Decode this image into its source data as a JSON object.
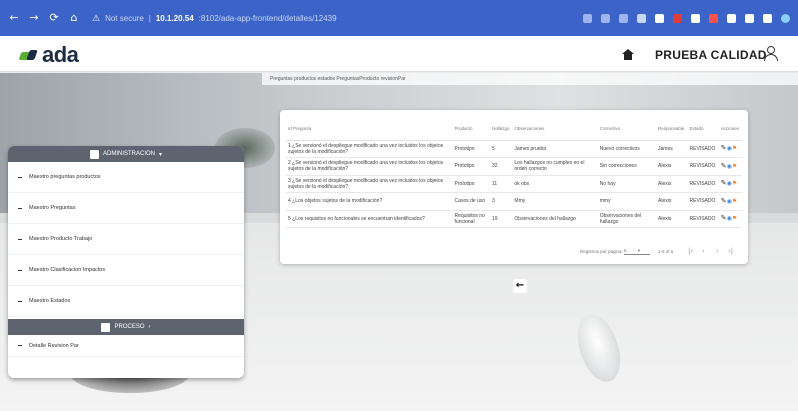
{
  "browser": {
    "security": "Not secure",
    "host": "10.1.20.54",
    "path": ":8102/ada-app-frontend/detalles/12439"
  },
  "header": {
    "logo_text": "ada",
    "user_name": "PRUEBA CALIDAD"
  },
  "breadcrumb": "Preguntas   productos   estados   PreguntasProducto   revisionPar",
  "table": {
    "columns": [
      "Id Pregunta",
      "Producto",
      "Hallazgo",
      "Observaciones",
      "Correctivo",
      "Responsable",
      "Estado",
      "Acciones"
    ],
    "rows": [
      {
        "id": "1",
        "pregunta": "¿Se versionó el despliegue modificado una vez incluidos los objetos sujetos de la modificación?",
        "producto": "Prototipo",
        "hallazgo": "5",
        "observaciones": "James prueba",
        "correctivo": "Nuevo correctivos",
        "responsable": "James",
        "estado": "REVISADO"
      },
      {
        "id": "2",
        "pregunta": "¿Se versionó el despliegue modificado una vez incluidos los objetos sujetos de la modificación?",
        "producto": "Prototipo",
        "hallazgo": "32",
        "observaciones": "Los hallazgos no cumplen en el orden correcto",
        "correctivo": "Sin correcciones",
        "responsable": "Alexis",
        "estado": "REVISADO"
      },
      {
        "id": "3",
        "pregunta": "¿Se versionó el despliegue modificado una vez incluidos los objetos sujetos de la modificación?",
        "producto": "Prototipo",
        "hallazgo": "11",
        "observaciones": "ok obs",
        "correctivo": "No hay",
        "responsable": "Alexis",
        "estado": "REVISADO"
      },
      {
        "id": "4",
        "pregunta": "¿Los objetos sujetos de la modificación?",
        "producto": "Casos de uso",
        "hallazgo": "3",
        "observaciones": "Mmy",
        "correctivo": "mmy",
        "responsable": "Alexis",
        "estado": "REVISADO"
      },
      {
        "id": "5",
        "pregunta": "¿Los requisitos no funcionales se encuentran identificados?",
        "producto": "Requisitos no funcional",
        "hallazgo": "19",
        "observaciones": "Observaciones del hallazgo",
        "correctivo": "Observaciones del hallazgo",
        "responsable": "Alexis",
        "estado": "REVISADO"
      }
    ],
    "footer": {
      "rows_label": "Registros por página:",
      "rows_value": "5",
      "range": "1-5 of 5"
    }
  },
  "sidebar": {
    "admin_header": "ADMINISTRACION",
    "admin_items": [
      "Maestro preguntas productos",
      "Maestro Preguntas",
      "Maestro Producto Trabajo",
      "Maestro Clasificacion Impactos",
      "Maestro Estados"
    ],
    "process_header": "PROCESO",
    "process_items": [
      "Detalle Revision Par"
    ]
  },
  "colors": {
    "browser_bar": "#3c64c8",
    "sidebar_header": "#5d6470",
    "logo_green": "#5bb033",
    "logo_navy": "#1d2d44"
  }
}
